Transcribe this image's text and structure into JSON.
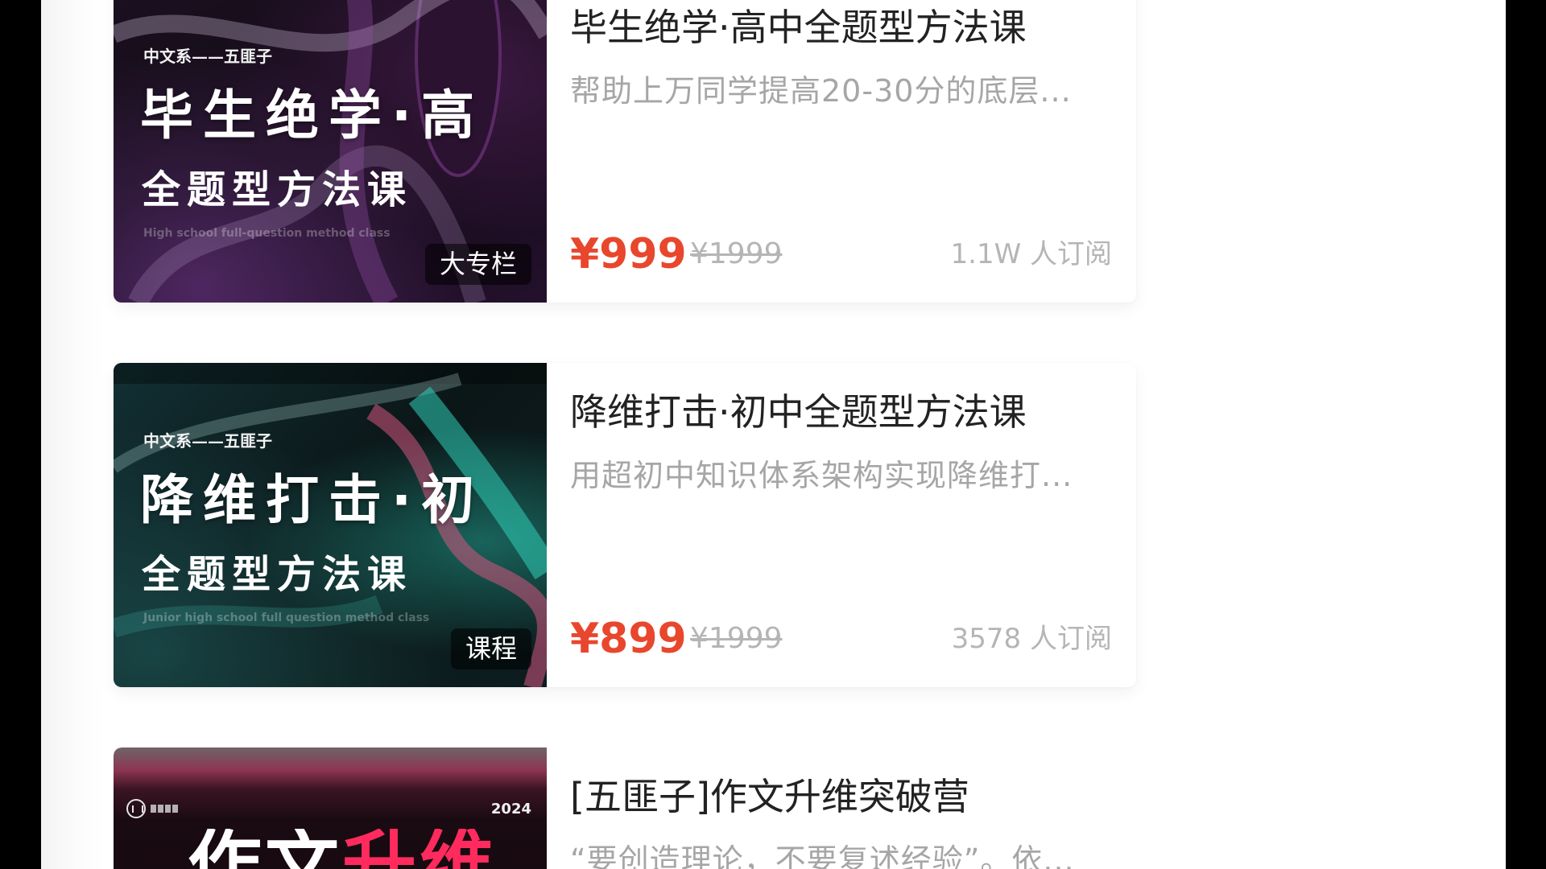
{
  "colors": {
    "price": "#e8472d",
    "title": "#222222",
    "muted": "#a6a6a6",
    "cover_accent": "#ff2b5e"
  },
  "courses": [
    {
      "title": "毕生绝学·高中全题型方法课",
      "subtitle": "帮助上万同学提高20-30分的底层...",
      "price": "¥999",
      "original_price": "¥1999",
      "subscribers": "1.1W 人订阅",
      "badge": "大专栏",
      "cover": {
        "author_line": "中文系——五匪子",
        "headline": "毕生绝学·高",
        "subline": "全题型方法课",
        "english_line": "High school full-question method class"
      }
    },
    {
      "title": "降维打击·初中全题型方法课",
      "subtitle": "用超初中知识体系架构实现降维打...",
      "price": "¥899",
      "original_price": "¥1999",
      "subscribers": "3578 人订阅",
      "badge": "课程",
      "cover": {
        "author_line": "中文系——五匪子",
        "headline": "降维打击·初",
        "subline": "全题型方法课",
        "english_line": "Junior high school full question method class"
      }
    },
    {
      "title": "[五匪子]作文升维突破营",
      "subtitle": "“要创造理论，不要复述经验”。依...",
      "cover": {
        "logo_icon": "brand-logo-icon",
        "year": "2024",
        "headline_main": "作文",
        "headline_accent": "升维"
      }
    }
  ]
}
